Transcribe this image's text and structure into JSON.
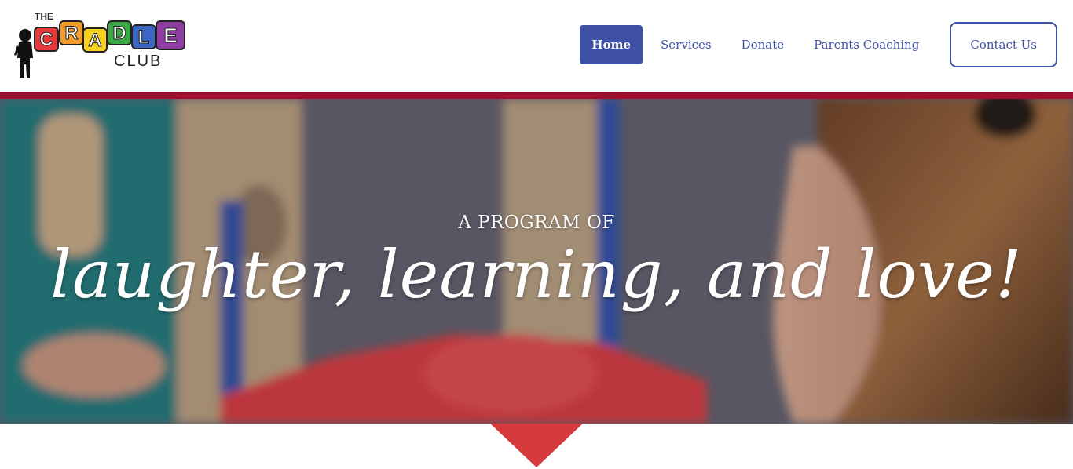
{
  "brand": {
    "logo_top": "THE",
    "logo_main": [
      "C",
      "R",
      "A",
      "D",
      "L",
      "E"
    ],
    "logo_sub": "CLUB",
    "logo_colors": [
      "#e63a3d",
      "#f39c2b",
      "#f7d11e",
      "#3aa845",
      "#3b66c4",
      "#8e3ea3"
    ]
  },
  "nav": {
    "items": [
      {
        "label": "Home",
        "active": true
      },
      {
        "label": "Services",
        "active": false
      },
      {
        "label": "Donate",
        "active": false
      },
      {
        "label": "Parents Coaching",
        "active": false
      }
    ],
    "contact_label": "Contact Us"
  },
  "hero": {
    "kicker": "A PROGRAM OF",
    "title": "laughter, learning, and love!"
  },
  "colors": {
    "primary": "#3f51a5",
    "accent_bar": "#a0102e",
    "pointer": "#d63a3d"
  },
  "icons": {
    "child_silhouette": "child-silhouette-icon",
    "scroll_pointer": "down-triangle-icon"
  }
}
